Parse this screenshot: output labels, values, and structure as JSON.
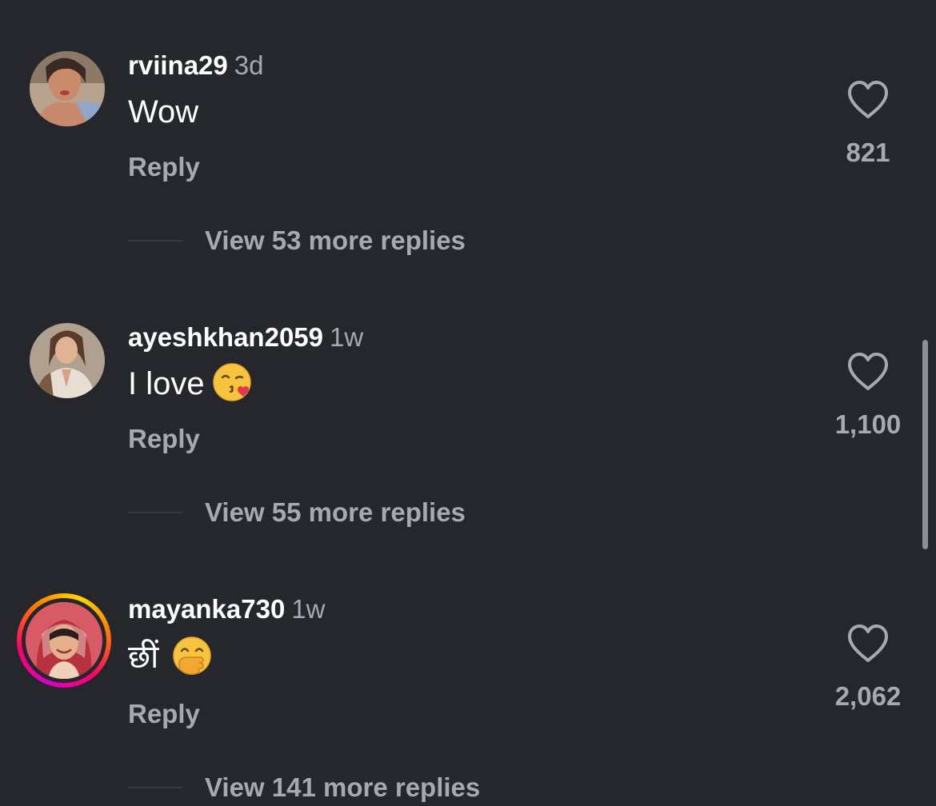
{
  "colors": {
    "background": "#25272c",
    "primary_text": "#ffffff",
    "secondary_text": "#a8a9ae",
    "story_ring": [
      "#d300c5",
      "#ff0069",
      "#ff7a00",
      "#ffd600"
    ]
  },
  "comments": [
    {
      "username": "rviina29",
      "time": "3d",
      "text": "Wow",
      "emoji": "",
      "reply_label": "Reply",
      "likes": "821",
      "view_replies": "View 53 more replies",
      "avatar_icon": "profile-photo",
      "has_story_ring": false
    },
    {
      "username": "ayeshkhan2059",
      "time": "1w",
      "text": "I love",
      "emoji": "face-blowing-a-kiss-emoji",
      "reply_label": "Reply",
      "likes": "1,100",
      "view_replies": "View 55 more replies",
      "avatar_icon": "profile-photo",
      "has_story_ring": false
    },
    {
      "username": "mayanka730",
      "time": "1w",
      "text": "छीं",
      "emoji": "face-with-hand-over-mouth-emoji",
      "reply_label": "Reply",
      "likes": "2,062",
      "view_replies": "View 141 more replies",
      "avatar_icon": "profile-photo",
      "has_story_ring": true
    }
  ],
  "icons": {
    "like": "heart-outline-icon"
  }
}
